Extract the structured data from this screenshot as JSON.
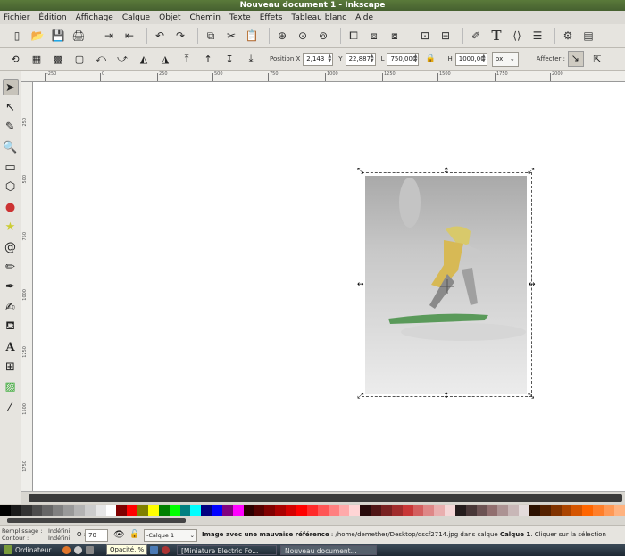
{
  "window": {
    "title": "Nouveau document 1 - Inkscape"
  },
  "menu": [
    "Fichier",
    "Édition",
    "Affichage",
    "Calque",
    "Objet",
    "Chemin",
    "Texte",
    "Effets",
    "Tableau blanc",
    "Aide"
  ],
  "toolbar_icons": [
    "new-doc-icon",
    "open-icon",
    "save-icon",
    "print-icon",
    "import-icon",
    "export-icon",
    "undo-icon",
    "redo-icon",
    "copy-icon",
    "cut-icon",
    "paste-icon",
    "zoom-selection-icon",
    "zoom-drawing-icon",
    "zoom-page-icon",
    "duplicate-icon",
    "clone-icon",
    "unlink-clone-icon",
    "group-icon",
    "ungroup-icon",
    "fill-stroke-icon",
    "text-font-icon",
    "xml-editor-icon",
    "align-icon",
    "preferences-icon",
    "document-properties-icon"
  ],
  "selector_toolbar": {
    "x_label": "Position X",
    "x_value": "2,143",
    "y_label": "Y",
    "y_value": "22,887",
    "w_label": "L",
    "w_value": "750,000",
    "h_label": "H",
    "h_value": "1000,00",
    "unit": "px",
    "affect_label": "Affecter :"
  },
  "ruler": {
    "h_labels": [
      "-250",
      "0",
      "250",
      "500",
      "750",
      "1000",
      "1250",
      "1500",
      "1750",
      "2000"
    ],
    "v_labels": [
      "250",
      "500",
      "750",
      "1000",
      "1250",
      "1500",
      "1750"
    ]
  },
  "tools": [
    "selector-tool",
    "node-tool",
    "tweak-tool",
    "zoom-tool",
    "rectangle-tool",
    "3d-box-tool",
    "ellipse-tool",
    "star-tool",
    "spiral-tool",
    "pencil-tool",
    "pen-tool",
    "calligraphy-tool",
    "paint-bucket-tool",
    "text-tool",
    "connector-tool",
    "gradient-tool",
    "dropper-tool"
  ],
  "palette": [
    "#000000",
    "#1a1a1a",
    "#333333",
    "#4d4d4d",
    "#666666",
    "#808080",
    "#999999",
    "#b3b3b3",
    "#cccccc",
    "#e6e6e6",
    "#ffffff",
    "#800000",
    "#ff0000",
    "#808000",
    "#ffff00",
    "#008000",
    "#00ff00",
    "#008080",
    "#00ffff",
    "#000080",
    "#0000ff",
    "#800080",
    "#ff00ff",
    "#2b0000",
    "#550000",
    "#800000",
    "#aa0000",
    "#d40000",
    "#ff0000",
    "#ff2a2a",
    "#ff5555",
    "#ff8080",
    "#ffaaaa",
    "#ffd5d5",
    "#280b0b",
    "#501616",
    "#782121",
    "#a02c2c",
    "#c83737",
    "#d35f5f",
    "#de8787",
    "#e9afaf",
    "#f4d7d7",
    "#241c1c",
    "#483737",
    "#6c5353",
    "#916f6f",
    "#ac9393",
    "#c8b7b7",
    "#e3dbdb",
    "#2b1100",
    "#552200",
    "#803300",
    "#aa4400",
    "#d45500",
    "#ff6600",
    "#ff7f2a",
    "#ff9955",
    "#ffb380"
  ],
  "status": {
    "fill_label": "Remplissage :",
    "stroke_label": "Contour :",
    "fill_value": "Indéfini",
    "stroke_value": "Indéfini",
    "opacity_label": "O :",
    "opacity_value": "70",
    "layer": "-Calque 1",
    "msg_bold": "Image avec une mauvaise référence",
    "msg_rest": " : /home/demether/Desktop/dscf2714.jpg dans calque ",
    "msg_layer": "Calque 1",
    "msg_tail": ". Cliquer sur la sélection",
    "tooltip": "Opacité, %"
  },
  "taskbar": {
    "start": "Ordinateur",
    "task1": "[Miniature Electric Fo...",
    "task2": "Nouveau document..."
  }
}
